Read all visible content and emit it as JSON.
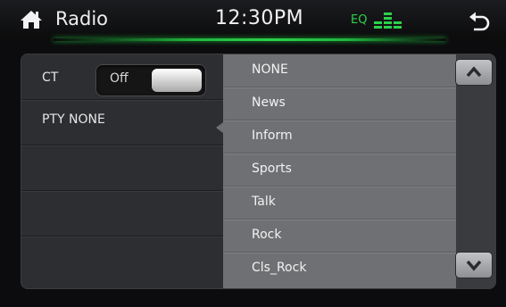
{
  "header": {
    "title": "Radio",
    "clock": "12:30PM",
    "eq_label": "EQ",
    "icons": [
      "home-icon",
      "equalizer-icon",
      "back-icon"
    ],
    "accent_color": "#2bd24a"
  },
  "settings": {
    "ct": {
      "label": "CT",
      "toggle_value": "Off"
    },
    "pty": {
      "label": "PTY NONE"
    }
  },
  "pty_list": {
    "items": [
      {
        "label": "NONE"
      },
      {
        "label": "News"
      },
      {
        "label": "Inform"
      },
      {
        "label": "Sports"
      },
      {
        "label": "Talk"
      },
      {
        "label": "Rock"
      },
      {
        "label": "Cls_Rock"
      }
    ],
    "scroll_icons": [
      "chevron-up-icon",
      "chevron-down-icon"
    ]
  }
}
